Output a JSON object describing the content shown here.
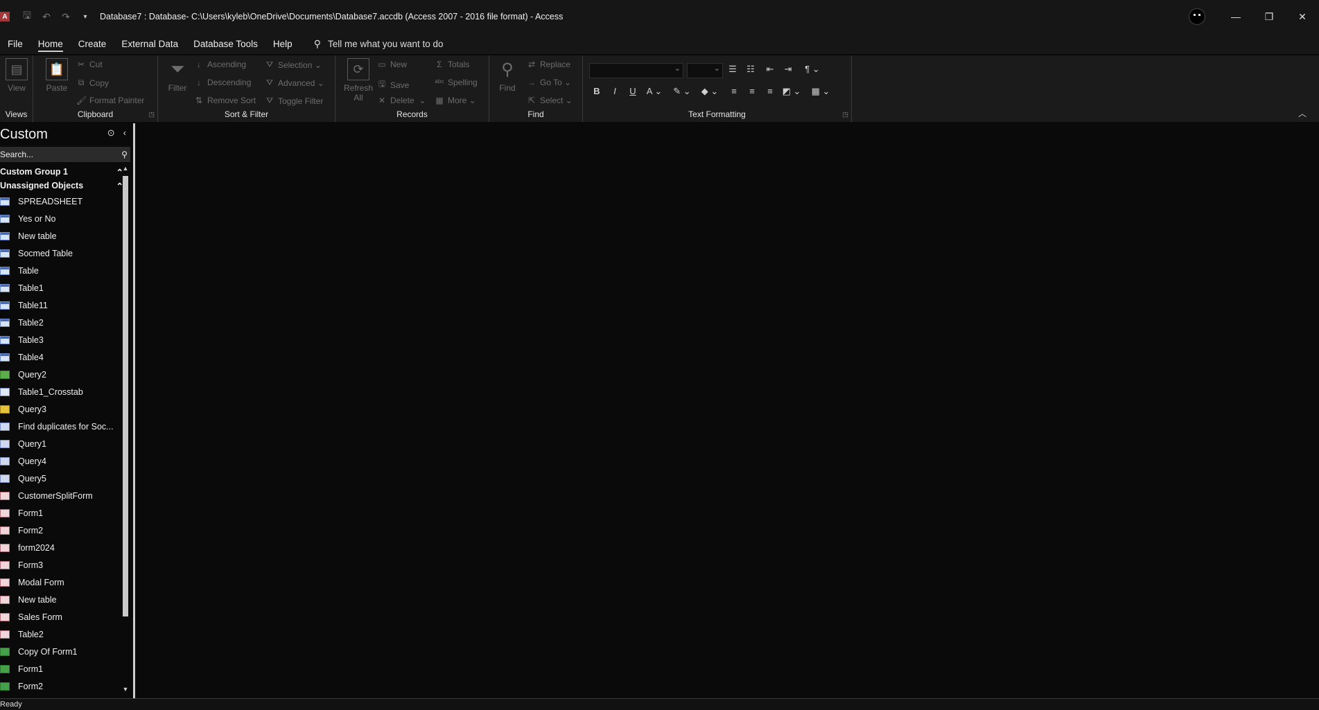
{
  "title_bar": {
    "app_badge": "A",
    "title": "Database7 : Database- C:\\Users\\kyleb\\OneDrive\\Documents\\Database7.accdb (Access 2007 - 2016 file format)  -  Access"
  },
  "menu": {
    "items": [
      "File",
      "Home",
      "Create",
      "External Data",
      "Database Tools",
      "Help"
    ],
    "tell_me": "Tell me what you want to do"
  },
  "ribbon": {
    "views": {
      "view": "View",
      "label": "Views"
    },
    "clipboard": {
      "paste": "Paste",
      "cut": "Cut",
      "copy": "Copy",
      "format_painter": "Format Painter",
      "label": "Clipboard"
    },
    "sort_filter": {
      "filter": "Filter",
      "ascending": "Ascending",
      "descending": "Descending",
      "remove_sort": "Remove Sort",
      "selection": "Selection",
      "advanced": "Advanced",
      "toggle_filter": "Toggle Filter",
      "label": "Sort & Filter"
    },
    "records": {
      "refresh": "Refresh",
      "refresh_all": "All",
      "new": "New",
      "save": "Save",
      "delete": "Delete",
      "totals": "Totals",
      "spelling": "Spelling",
      "more": "More",
      "label": "Records"
    },
    "find": {
      "find": "Find",
      "replace": "Replace",
      "goto": "Go To",
      "select": "Select",
      "label": "Find"
    },
    "text_formatting": {
      "label": "Text Formatting"
    }
  },
  "nav": {
    "title": "Custom",
    "search_placeholder": "Search...",
    "groups": [
      "Custom Group 1",
      "Unassigned Objects"
    ],
    "objects": [
      {
        "name": "SPREADSHEET",
        "icon": "table"
      },
      {
        "name": "Yes or No",
        "icon": "table"
      },
      {
        "name": "New table",
        "icon": "table"
      },
      {
        "name": "Socmed Table",
        "icon": "table"
      },
      {
        "name": "Table",
        "icon": "table"
      },
      {
        "name": "Table1",
        "icon": "table"
      },
      {
        "name": "Table11",
        "icon": "table"
      },
      {
        "name": "Table2",
        "icon": "table"
      },
      {
        "name": "Table3",
        "icon": "table"
      },
      {
        "name": "Table4",
        "icon": "table"
      },
      {
        "name": "Query2",
        "icon": "qmake"
      },
      {
        "name": "Table1_Crosstab",
        "icon": "qcross"
      },
      {
        "name": "Query3",
        "icon": "qupd"
      },
      {
        "name": "Find duplicates for Soc...",
        "icon": "query"
      },
      {
        "name": "Query1",
        "icon": "query"
      },
      {
        "name": "Query4",
        "icon": "query"
      },
      {
        "name": "Query5",
        "icon": "query"
      },
      {
        "name": "CustomerSplitForm",
        "icon": "form"
      },
      {
        "name": "Form1",
        "icon": "form"
      },
      {
        "name": "Form2",
        "icon": "form"
      },
      {
        "name": "form2024",
        "icon": "form"
      },
      {
        "name": "Form3",
        "icon": "form"
      },
      {
        "name": "Modal Form",
        "icon": "form"
      },
      {
        "name": "New table",
        "icon": "form"
      },
      {
        "name": "Sales Form",
        "icon": "form"
      },
      {
        "name": "Table2",
        "icon": "form"
      },
      {
        "name": "Copy Of Form1",
        "icon": "formgreen"
      },
      {
        "name": "Form1",
        "icon": "formgreen"
      },
      {
        "name": "Form2",
        "icon": "formgreen"
      }
    ]
  },
  "status": {
    "text": "Ready"
  }
}
